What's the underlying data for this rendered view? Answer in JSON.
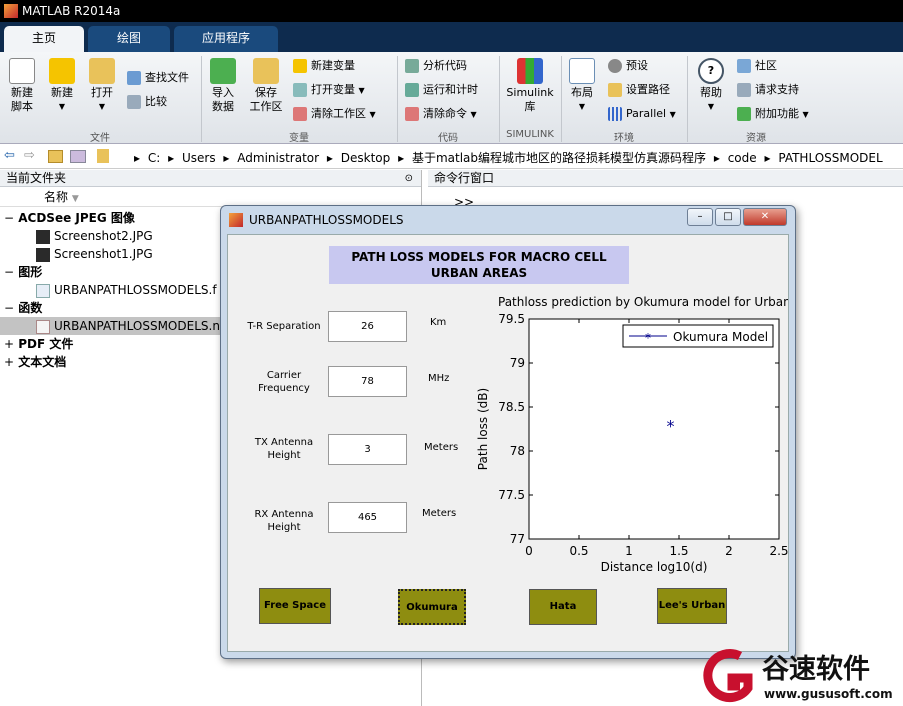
{
  "window": {
    "title": "MATLAB R2014a"
  },
  "tabs": [
    {
      "label": "主页",
      "active": true
    },
    {
      "label": "绘图",
      "active": false
    },
    {
      "label": "应用程序",
      "active": false
    }
  ],
  "ribbon": {
    "file": {
      "new_script": "新建\n脚本",
      "new": "新建",
      "open": "打开",
      "find_files": "查找文件",
      "compare": "比较",
      "group": "文件"
    },
    "variable": {
      "import": "导入\n数据",
      "save_ws": "保存\n工作区",
      "new_var": "新建变量",
      "open_var": "打开变量",
      "clear_ws": "清除工作区",
      "group": "变量"
    },
    "code": {
      "analyze": "分析代码",
      "run_time": "运行和计时",
      "clear_cmd": "清除命令",
      "group": "代码"
    },
    "simulink": {
      "label": "Simulink\n库",
      "group": "SIMULINK"
    },
    "env": {
      "layout": "布局",
      "prefs": "预设",
      "set_path": "设置路径",
      "parallel": "Parallel",
      "group": "环境"
    },
    "resources": {
      "help": "帮助",
      "community": "社区",
      "support": "请求支持",
      "addons": "附加功能",
      "group": "资源"
    }
  },
  "address": {
    "crumbs": [
      "C:",
      "Users",
      "Administrator",
      "Desktop",
      "基于matlab编程城市地区的路径损耗模型仿真源码程序",
      "code",
      "PATHLOSSMODEL"
    ]
  },
  "left_pane": {
    "title": "当前文件夹",
    "column": "名称",
    "tree": [
      {
        "label": "ACDSee JPEG 图像",
        "type": "cat",
        "sign": "−"
      },
      {
        "label": "Screenshot2.JPG",
        "type": "jpg"
      },
      {
        "label": "Screenshot1.JPG",
        "type": "jpg"
      },
      {
        "label": "图形",
        "type": "cat",
        "sign": "−"
      },
      {
        "label": "URBANPATHLOSSMODELS.f",
        "type": "fig"
      },
      {
        "label": "函数",
        "type": "cat",
        "sign": "−"
      },
      {
        "label": "URBANPATHLOSSMODELS.n",
        "type": "m",
        "selected": true
      },
      {
        "label": "PDF 文件",
        "type": "cat",
        "sign": "+"
      },
      {
        "label": "文本文档",
        "type": "cat",
        "sign": "+"
      }
    ]
  },
  "right_pane": {
    "title": "命令行窗口",
    "prompt": ">>"
  },
  "figure": {
    "title": "URBANPATHLOSSMODELS",
    "header": "PATH LOSS MODELS FOR MACRO CELL\nURBAN AREAS",
    "fields": [
      {
        "label": "T-R Separation",
        "value": "26",
        "unit": "Km"
      },
      {
        "label": "Carrier\nFrequency",
        "value": "78",
        "unit": "MHz"
      },
      {
        "label": "TX Antenna\nHeight",
        "value": "3",
        "unit": "Meters"
      },
      {
        "label": "RX Antenna\nHeight",
        "value": "465",
        "unit": "Meters"
      }
    ],
    "buttons": [
      "Free Space",
      "Okumura",
      "Hata",
      "Lee's Urban"
    ]
  },
  "chart_data": {
    "type": "scatter",
    "title": "Pathloss prediction by Okumura model for Urban A",
    "xlabel": "Distance log10(d)",
    "ylabel": "Path loss (dB)",
    "xlim": [
      0,
      2.5
    ],
    "ylim": [
      77,
      79.5
    ],
    "xticks": [
      "0",
      "0.5",
      "1",
      "1.5",
      "2",
      "2.5"
    ],
    "yticks": [
      "77",
      "77.5",
      "78",
      "78.5",
      "79",
      "79.5"
    ],
    "series": [
      {
        "name": "Okumura Model",
        "points": [
          [
            1.415,
            78.3
          ]
        ],
        "color": "#00008b",
        "marker": "*"
      }
    ],
    "legend": "top-right",
    "grid": false
  },
  "watermark": {
    "brand": "谷速软件",
    "url": "www.gususoft.com",
    "color": "#c8102e"
  }
}
